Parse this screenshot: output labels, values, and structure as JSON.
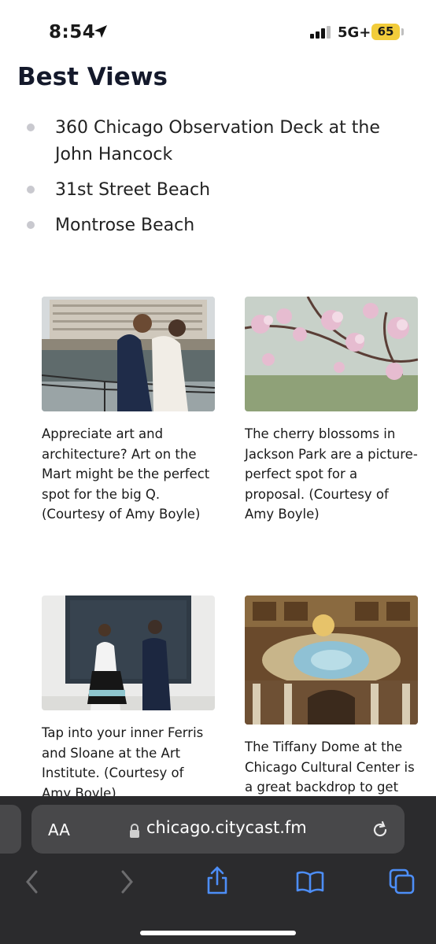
{
  "status_bar": {
    "time": "8:54",
    "network": "5G+",
    "battery": "65"
  },
  "section": {
    "title": "Best Views",
    "items": [
      "360 Chicago Observation Deck at the John Hancock",
      "31st Street Beach",
      "Montrose Beach"
    ]
  },
  "cards": [
    {
      "image": "couple kissing by Chicago river",
      "caption": "Appreciate art and architecture? Art on the Mart might be the perfect spot for the big Q. (Courtesy of Amy Boyle)"
    },
    {
      "image": "pink cherry blossoms",
      "caption": "The cherry blossoms in Jackson Park are a picture-perfect spot for a proposal. (Courtesy of Amy Boyle)"
    },
    {
      "image": "couple holding hands in front of painting",
      "caption": "Tap into your inner Ferris and Sloane at the Art Institute. (Courtesy of Amy Boyle)"
    },
    {
      "image": "Tiffany glass dome interior",
      "caption": "The Tiffany Dome at the Chicago Cultural Center is a great backdrop to get"
    }
  ],
  "browser": {
    "text_size_label": "AA",
    "url": "chicago.citycast.fm",
    "icons": [
      "back-icon",
      "forward-icon",
      "share-icon",
      "bookmarks-icon",
      "tabs-icon"
    ],
    "accent_color": "#4d8ef7"
  }
}
